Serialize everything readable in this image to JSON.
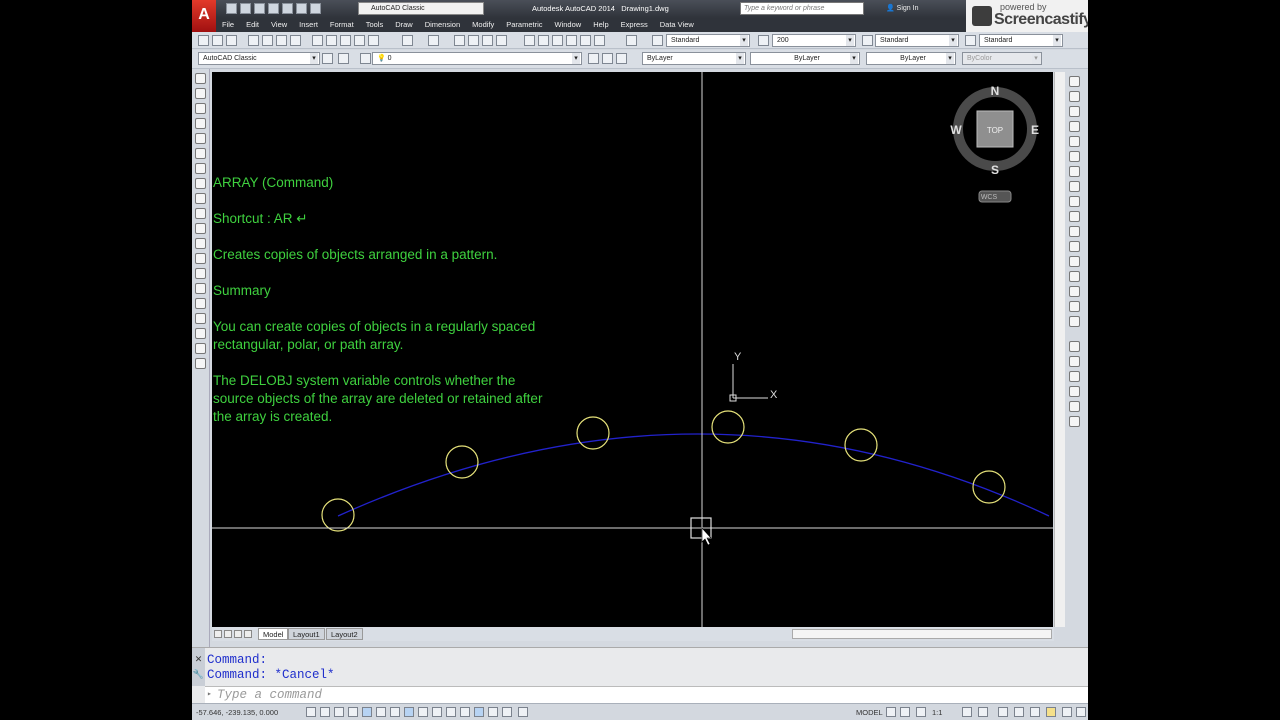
{
  "title_bar": {
    "logo_letter": "A",
    "workspace": "AutoCAD Classic",
    "app_title": "Autodesk AutoCAD 2014",
    "document": "Drawing1.dwg",
    "search_placeholder": "Type a keyword or phrase",
    "sign_in": "Sign In"
  },
  "watermark": {
    "powered_by": "powered by",
    "brand": "Screencastify"
  },
  "menu": [
    "File",
    "Edit",
    "View",
    "Insert",
    "Format",
    "Tools",
    "Draw",
    "Dimension",
    "Modify",
    "Parametric",
    "Window",
    "Help",
    "Express",
    "Data View"
  ],
  "styles_toolbar": {
    "text_style": "Standard",
    "dim_scale": "200",
    "table_style": "Standard",
    "multileader_style": "Standard"
  },
  "layers_toolbar": {
    "workspace": "AutoCAD Classic",
    "layer": "0",
    "color": "ByLayer",
    "linetype": "ByLayer",
    "lineweight": "ByLayer",
    "plot_style": "ByColor"
  },
  "annotation": {
    "heading": "ARRAY (Command)",
    "shortcut": "Shortcut : AR ↵",
    "description": "Creates copies of objects arranged in a pattern.",
    "summary_heading": "Summary",
    "summary_line1": "You can create copies of objects in a regularly spaced",
    "summary_line2": "rectangular, polar, or path array.",
    "delobj_line1": "The DELOBJ system variable controls whether the",
    "delobj_line2": "source objects of the array are deleted or retained after",
    "delobj_line3": "the array is created."
  },
  "viewcube": {
    "north": "N",
    "south": "S",
    "east": "E",
    "west": "W",
    "face": "TOP",
    "ucs": "WCS"
  },
  "ucs_icon": {
    "x": "X",
    "y": "Y"
  },
  "colors": {
    "annotation_text": "#3fd13f",
    "path_curve": "#2222cc",
    "array_circles": "#e6e27a",
    "crosshair": "#ffffff",
    "command_text": "#1f2ecc"
  },
  "layout_tabs": [
    "Model",
    "Layout1",
    "Layout2"
  ],
  "command_history": [
    "Command:",
    "Command: *Cancel*"
  ],
  "command_input": {
    "placeholder": "Type a command"
  },
  "status_bar": {
    "coordinates": "-57.646, -239.135, 0.000",
    "space": "MODEL",
    "annotation_scale": "1:1"
  }
}
